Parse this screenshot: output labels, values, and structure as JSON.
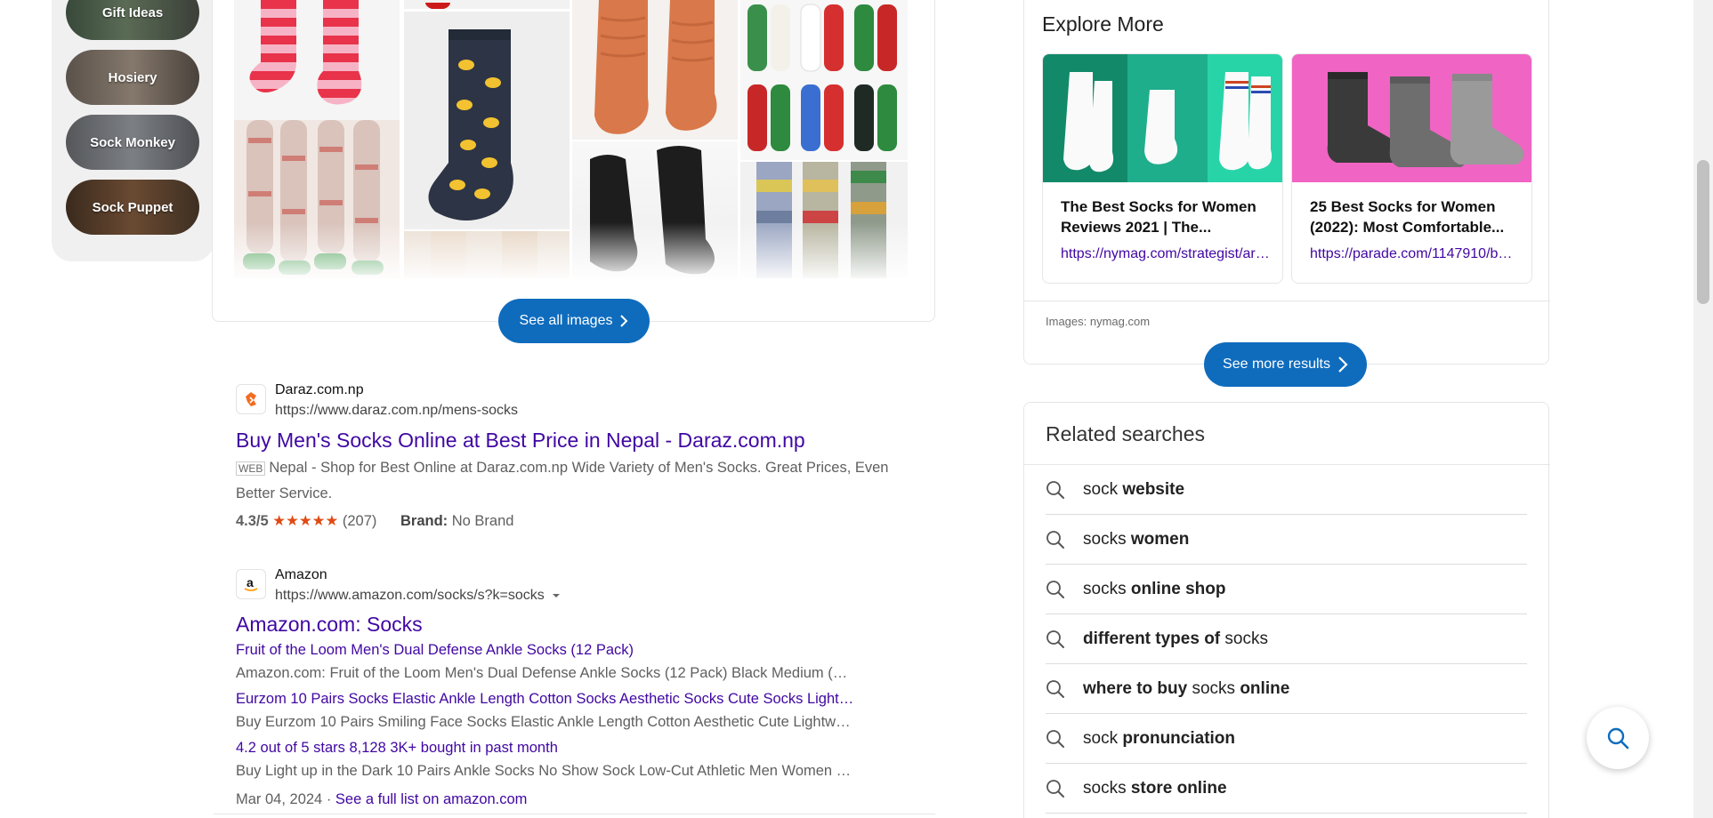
{
  "pills": [
    {
      "label": "Gift Ideas"
    },
    {
      "label": "Hosiery"
    },
    {
      "label": "Sock Monkey"
    },
    {
      "label": "Sock Puppet"
    }
  ],
  "images_section": {
    "see_all_label": "See all images"
  },
  "results": [
    {
      "site_name": "Daraz.com.np",
      "url": "https://www.daraz.com.np/mens-socks",
      "title": "Buy Men's Socks Online at Best Price in Nepal - Daraz.com.np",
      "web_tag": "WEB",
      "snippet": "Nepal - Shop for Best Online at Daraz.com.np Wide Variety of Men's Socks. Great Prices, Even Better Service.",
      "rating": "4.3/5",
      "stars": "★★★★★",
      "review_count": "(207)",
      "brand_label": "Brand:",
      "brand_value": "No Brand"
    },
    {
      "site_name": "Amazon",
      "url": "https://www.amazon.com/socks/s?k=socks",
      "title": "Amazon.com: Socks",
      "sublinks": [
        {
          "link": "Fruit of the Loom Men's Dual Defense Ankle Socks (12 Pack)",
          "text": "Amazon.com: Fruit of the Loom Men's Dual Defense Ankle Socks (12 Pack) Black Medium (…"
        },
        {
          "link": "Eurzom 10 Pairs Socks Elastic Ankle Length Cotton Socks Aesthetic Socks Cute Socks Light…",
          "text": "Buy Eurzom 10 Pairs Smiling Face Socks Elastic Ankle Length Cotton Aesthetic Cute Lightw…"
        },
        {
          "link": "4.2 out of 5 stars 8,128 3K+ bought in past month",
          "text": "Buy Light up in the Dark 10 Pairs Ankle Socks No Show Sock Low-Cut Athletic Men Women …"
        }
      ],
      "date": "Mar 04, 2024",
      "separator": " · ",
      "full_list_link": "See a full list on amazon.com"
    }
  ],
  "explore": {
    "title": "Explore More",
    "cards": [
      {
        "title": "The Best Socks for Women Reviews 2021 | The...",
        "link": "https://nymag.com/strategist/article/best-socks-for-women.html"
      },
      {
        "title": "25 Best Socks for Women (2022): Most Comfortable...",
        "link": "https://parade.com/1147910/best-socks-for-women"
      }
    ],
    "images_credit": "Images: nymag.com",
    "see_more_label": "See more results"
  },
  "related": {
    "title": "Related searches",
    "items": [
      {
        "parts": [
          {
            "t": "sock ",
            "b": false
          },
          {
            "t": "website",
            "b": true
          }
        ]
      },
      {
        "parts": [
          {
            "t": "socks ",
            "b": false
          },
          {
            "t": "women",
            "b": true
          }
        ]
      },
      {
        "parts": [
          {
            "t": "socks ",
            "b": false
          },
          {
            "t": "online shop",
            "b": true
          }
        ]
      },
      {
        "parts": [
          {
            "t": "different types of ",
            "b": true
          },
          {
            "t": "socks",
            "b": false
          }
        ]
      },
      {
        "parts": [
          {
            "t": "where to buy ",
            "b": true
          },
          {
            "t": "socks ",
            "b": false
          },
          {
            "t": "online",
            "b": true
          }
        ]
      },
      {
        "parts": [
          {
            "t": "sock ",
            "b": false
          },
          {
            "t": "pronunciation",
            "b": true
          }
        ]
      },
      {
        "parts": [
          {
            "t": "socks ",
            "b": false
          },
          {
            "t": "store online",
            "b": true
          }
        ]
      }
    ]
  },
  "colors": {
    "accent_blue": "#0f6cbd",
    "link_purple": "#4007a2",
    "star_orange": "#e04a14"
  },
  "icons": [
    "search-icon",
    "chevron-right-icon",
    "caret-down-icon",
    "daraz-logo-icon",
    "amazon-logo-icon"
  ]
}
